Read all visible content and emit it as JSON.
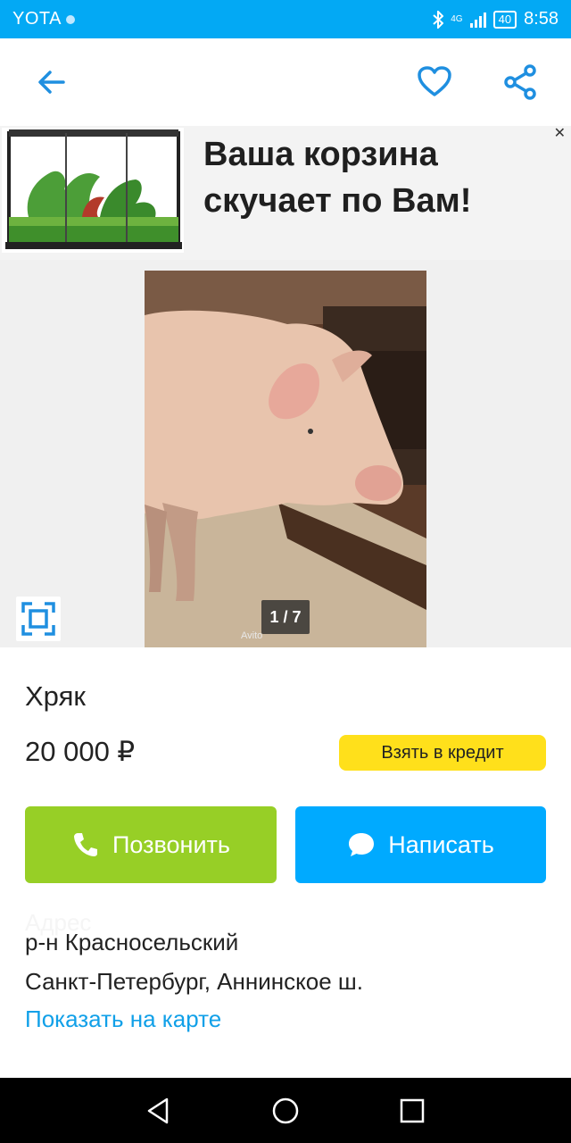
{
  "status_bar": {
    "carrier": "YOTA",
    "network": "4G",
    "battery": "40",
    "time": "8:58"
  },
  "app_bar": {
    "icons": [
      "back-arrow-icon",
      "heart-icon",
      "share-icon"
    ]
  },
  "ad": {
    "text": "Ваша корзина скучает по Вам!",
    "image_icon": "terrarium-image"
  },
  "gallery": {
    "counter": "1 / 7",
    "watermark": "Avito",
    "photo": "pig-photo",
    "fullscreen_icon": "fullscreen-icon"
  },
  "listing": {
    "title": "Хряк",
    "price": "20 000 ₽",
    "credit_button": "Взять в кредит",
    "call_button": "Позвонить",
    "message_button": "Написать",
    "location_faded": "Адрес",
    "district": "р-н Красносельский",
    "address": "Санкт-Петербург, Аннинское ш.",
    "map_link": "Показать на карте"
  },
  "colors": {
    "status_bar": "#03a9f4",
    "accent_blue": "#00aaff",
    "call_green": "#97cf26",
    "credit_yellow": "#ffe01b",
    "link_blue": "#11a0e8"
  },
  "nav_bar": {
    "icons": [
      "back-triangle-icon",
      "home-circle-icon",
      "recents-square-icon"
    ]
  }
}
